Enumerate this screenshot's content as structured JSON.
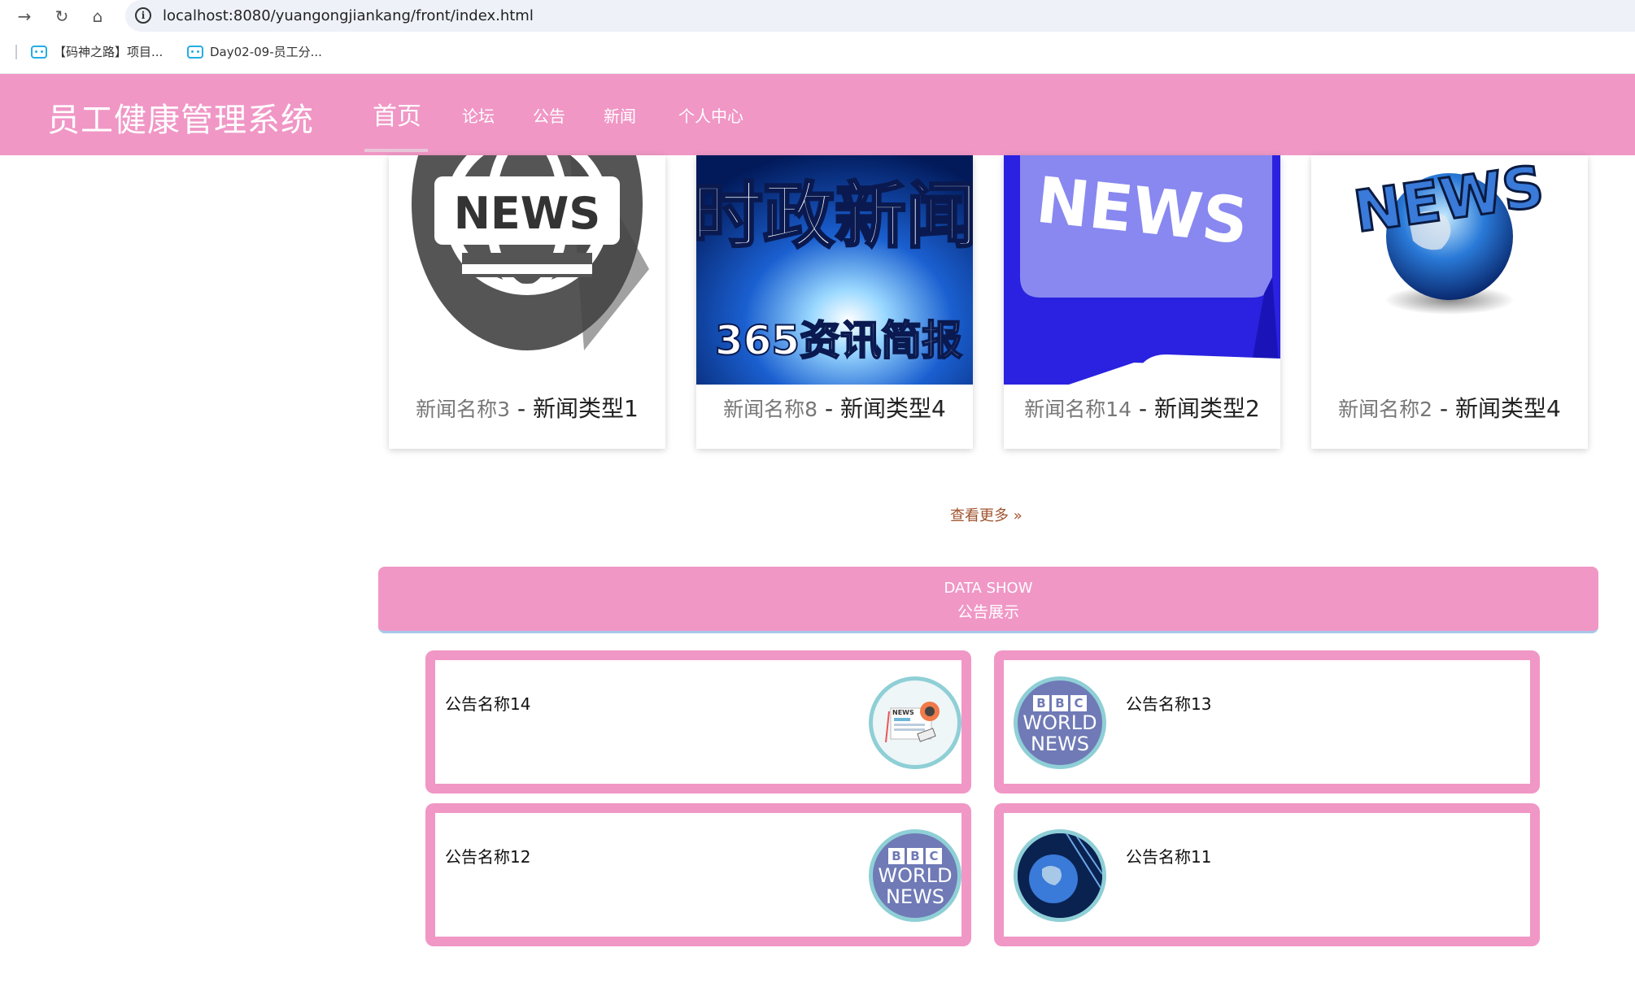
{
  "browser": {
    "url": "localhost:8080/yuangongjiankang/front/index.html",
    "bookmarks": [
      "【码神之路】项目...",
      "Day02-09-员工分..."
    ]
  },
  "header": {
    "brand": "员工健康管理系统",
    "nav": [
      "首页",
      "论坛",
      "公告",
      "新闻",
      "个人中心"
    ],
    "active_nav": "首页"
  },
  "news_cards": [
    {
      "name": "新闻名称3",
      "type": "新闻类型1",
      "image": "news-globe-icon"
    },
    {
      "name": "新闻名称8",
      "type": "新闻类型4",
      "image": "时政新闻 365资讯简报"
    },
    {
      "name": "新闻名称14",
      "type": "新闻类型2",
      "image": "news-keyboard-key"
    },
    {
      "name": "新闻名称2",
      "type": "新闻类型4",
      "image": "news-3d-globe"
    }
  ],
  "more_link": "查看更多",
  "data_show": {
    "en": "DATA SHOW",
    "zh": "公告展示"
  },
  "notices": [
    {
      "title": "公告名称14",
      "thumb": "newspaper-icon"
    },
    {
      "title": "公告名称13",
      "thumb": "bbc-world-news-logo"
    },
    {
      "title": "公告名称12",
      "thumb": "bbc-world-news-logo"
    },
    {
      "title": "公告名称11",
      "thumb": "globe-tech-image"
    }
  ],
  "image_text": {
    "card1": "NEWS",
    "card2_top": "时政新闻",
    "card2_bottom": "365资讯简报",
    "card3": "NEWS",
    "card4": "NEWS",
    "bbc_letters": [
      "B",
      "B",
      "C"
    ],
    "bbc_world": "WORLD",
    "bbc_news": "NEWS",
    "newspaper": "NEWS"
  },
  "colors": {
    "theme_pink": "#f097c6",
    "more_link": "#a0522d"
  }
}
